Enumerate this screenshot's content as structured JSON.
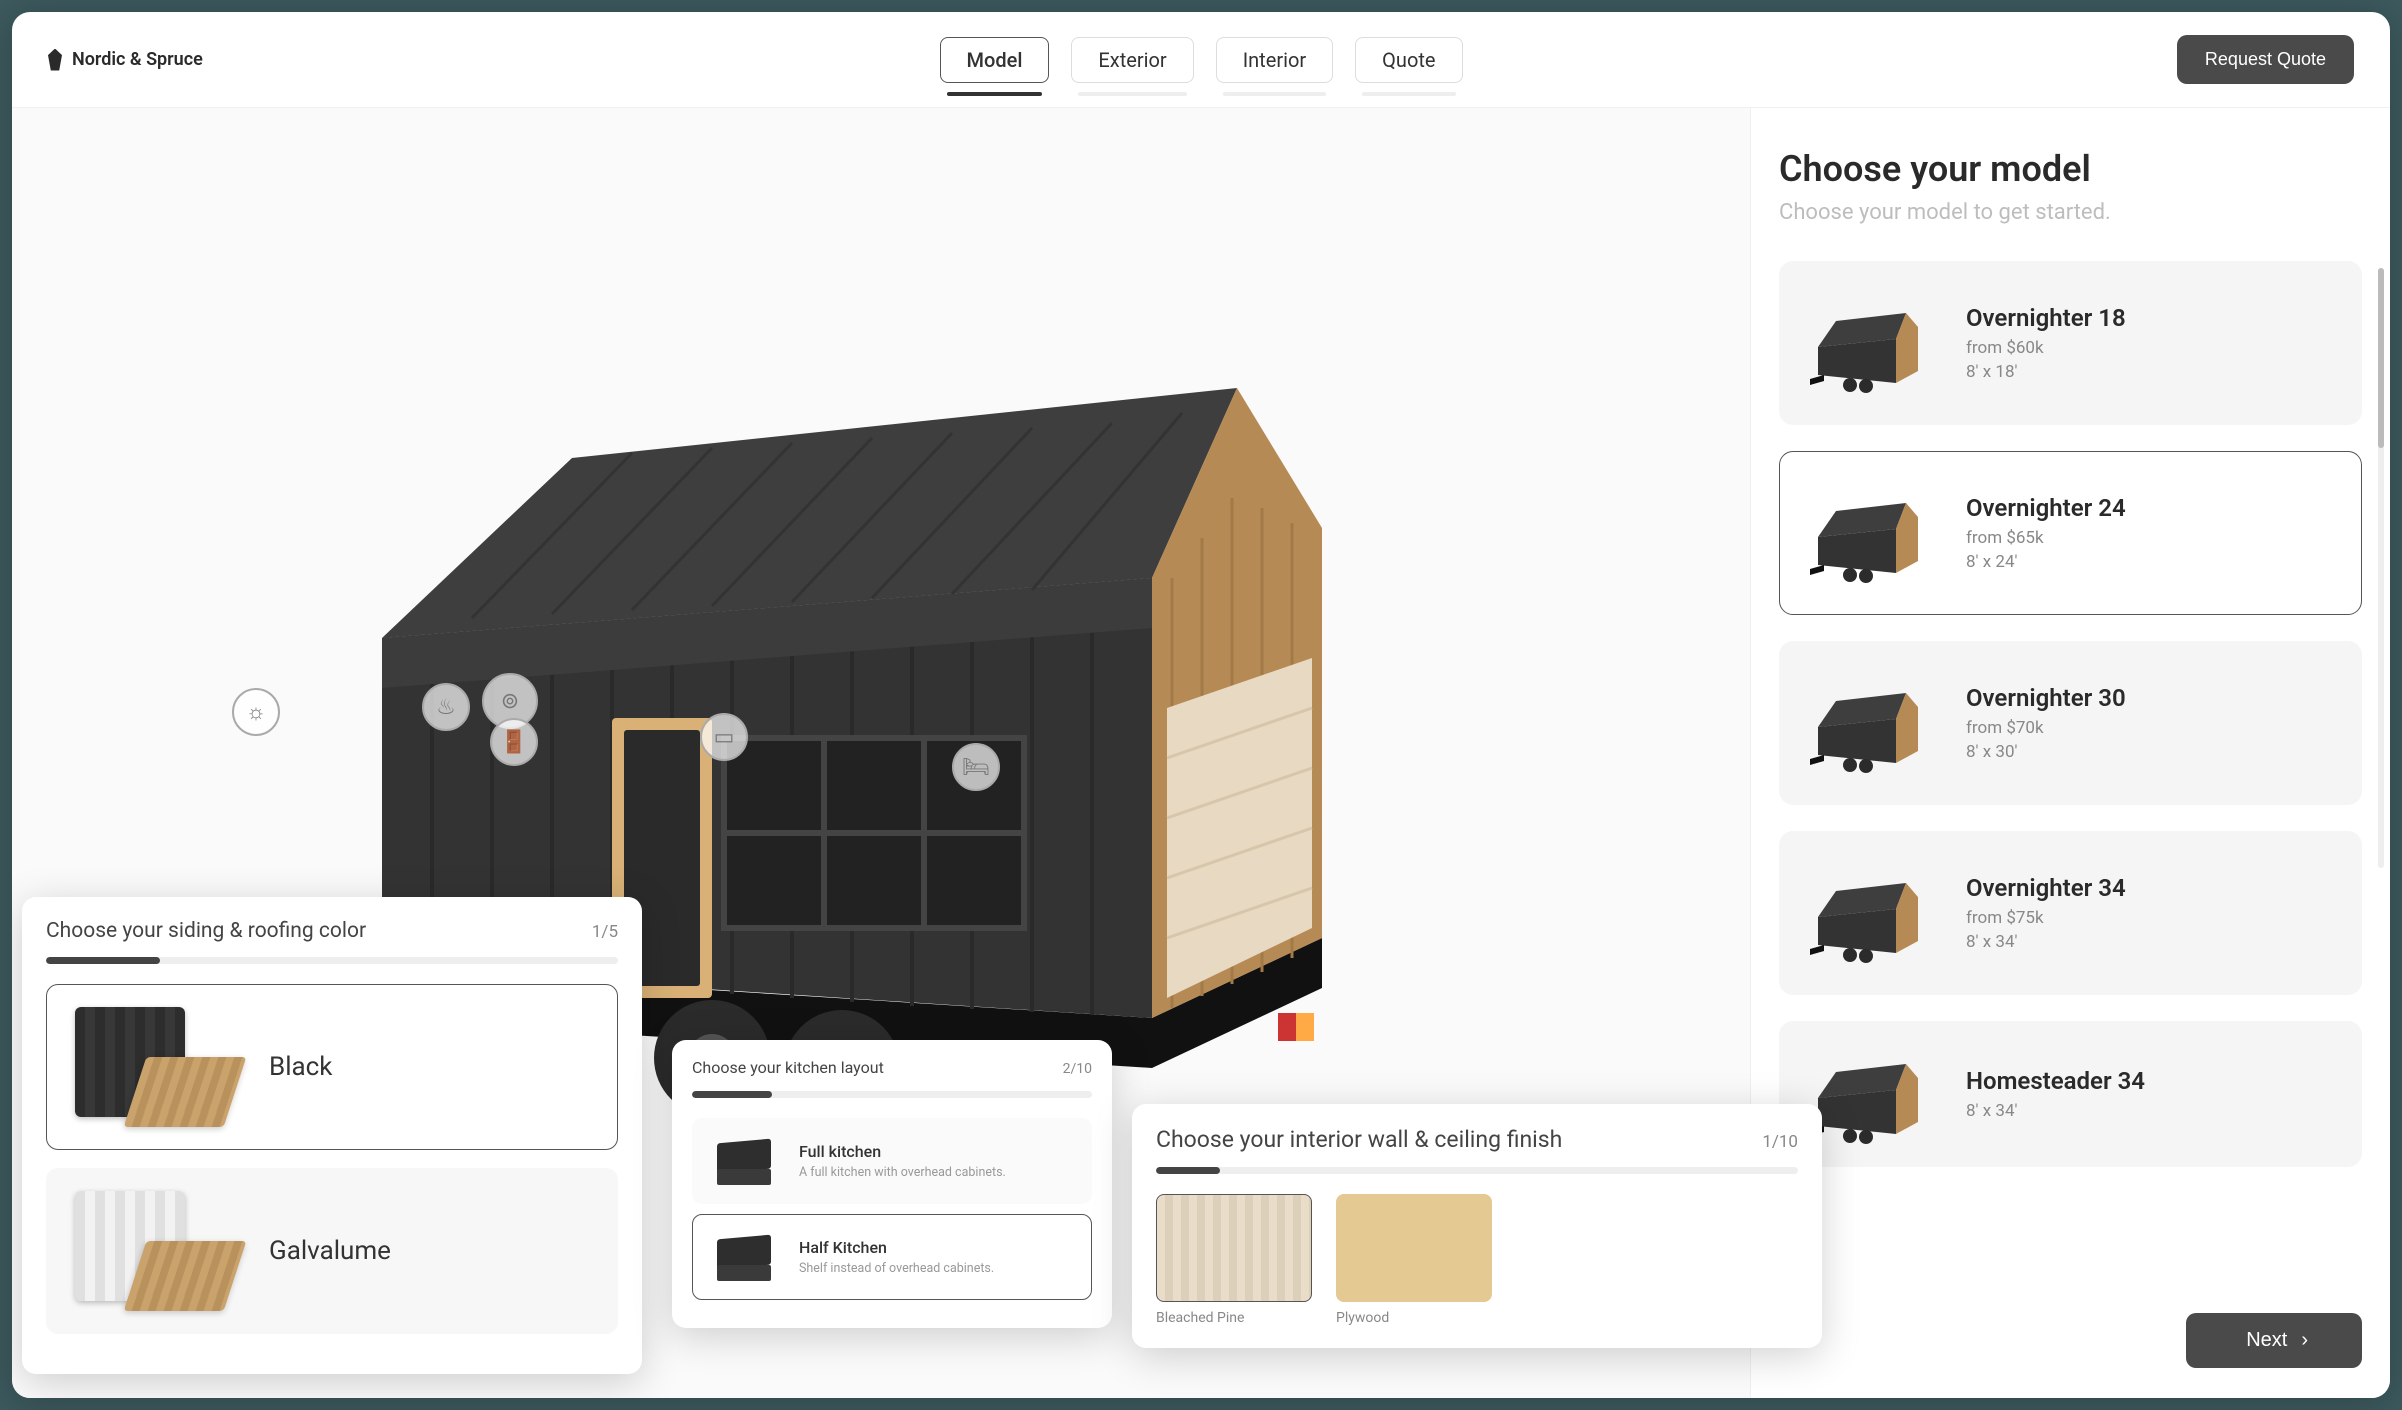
{
  "brand": {
    "name": "Nordic & Spruce"
  },
  "tabs": {
    "model": "Model",
    "exterior": "Exterior",
    "interior": "Interior",
    "quote": "Quote"
  },
  "cta": {
    "request_quote": "Request Quote",
    "next": "Next"
  },
  "sidebar": {
    "heading": "Choose your model",
    "subheading": "Choose your model to get started.",
    "models": [
      {
        "name": "Overnighter 18",
        "price": "from $60k",
        "dims": "8' x 18'"
      },
      {
        "name": "Overnighter 24",
        "price": "from $65k",
        "dims": "8' x 24'"
      },
      {
        "name": "Overnighter 30",
        "price": "from $70k",
        "dims": "8' x 30'"
      },
      {
        "name": "Overnighter 34",
        "price": "from $75k",
        "dims": "8' x 34'"
      },
      {
        "name": "Homesteader 34",
        "price": "",
        "dims": "8' x 34'"
      }
    ],
    "selected_index": 1
  },
  "cards": {
    "siding": {
      "title": "Choose your siding & roofing color",
      "step": "1/5",
      "progress_pct": 20,
      "options": [
        {
          "label": "Black"
        },
        {
          "label": "Galvalume"
        }
      ],
      "selected_index": 0
    },
    "kitchen": {
      "title": "Choose your kitchen layout",
      "step": "2/10",
      "progress_pct": 20,
      "options": [
        {
          "name": "Full kitchen",
          "desc": "A full kitchen with overhead cabinets."
        },
        {
          "name": "Half Kitchen",
          "desc": "Shelf instead of overhead cabinets."
        }
      ],
      "selected_index": 1
    },
    "interior": {
      "title": "Choose your interior wall & ceiling finish",
      "step": "1/10",
      "progress_pct": 10,
      "options": [
        {
          "label": "Bleached Pine"
        },
        {
          "label": "Plywood"
        }
      ],
      "selected_index": 0
    }
  },
  "hotspots": [
    "sun-icon",
    "cook-icon",
    "wheel-icon",
    "door-icon",
    "window-icon",
    "bed-icon"
  ]
}
